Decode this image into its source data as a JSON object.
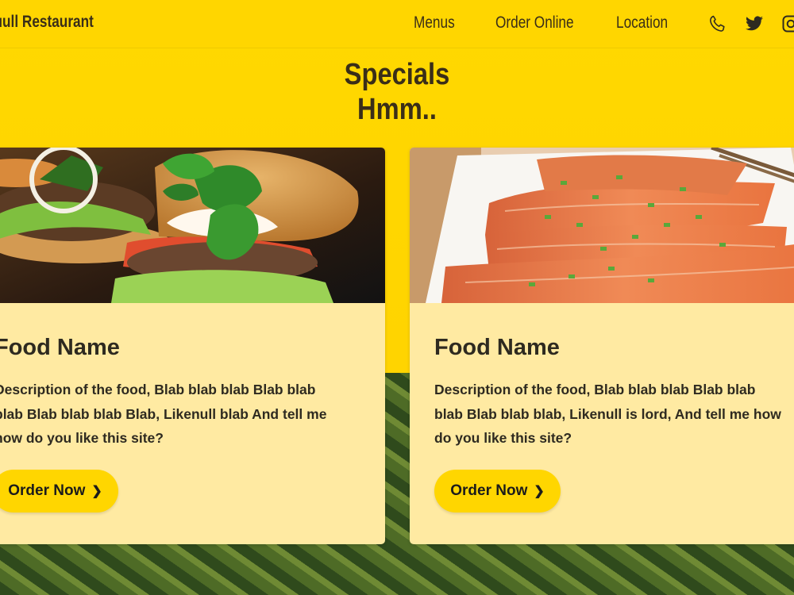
{
  "header": {
    "brand": "nuull Restaurant",
    "nav": [
      {
        "label": "Menus"
      },
      {
        "label": "Order Online"
      },
      {
        "label": "Location"
      }
    ],
    "icons": [
      "phone-icon",
      "twitter-icon",
      "instagram-icon"
    ]
  },
  "section": {
    "title_line1": "Specials",
    "title_line2": "Hmm.."
  },
  "cards": [
    {
      "image": "burger",
      "name": "Food Name",
      "description": "Description of the food, Blab blab blab Blab blab blab Blab blab blab Blab, Likenull blab And tell me how do you like this site?",
      "button": "Order Now",
      "button_icon": "chevron-right-icon"
    },
    {
      "image": "salmon",
      "name": "Food Name",
      "description": "Description of the food, Blab blab blab Blab blab blab Blab blab blab, Likenull is lord, And tell me how do you like this site?",
      "button": "Order Now",
      "button_icon": "chevron-right-icon"
    }
  ],
  "colors": {
    "accent": "#ffd600",
    "card": "#ffeaa2",
    "text": "#2e2a20"
  }
}
